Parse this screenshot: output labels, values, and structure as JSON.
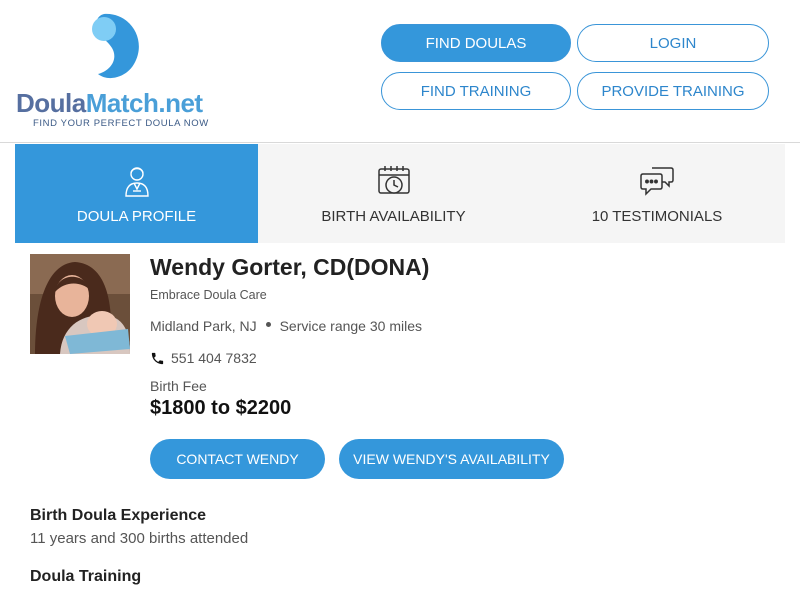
{
  "brand": {
    "logo_word_part1": "Doula",
    "logo_word_part2": "Match.net",
    "tagline": "FIND YOUR PERFECT DOULA NOW",
    "colors": {
      "primary": "#3497db",
      "dark_blue": "#566fa0",
      "light_blue": "#67c0f0"
    }
  },
  "nav": {
    "find_doulas": "FIND DOULAS",
    "login": "LOGIN",
    "find_training": "FIND TRAINING",
    "provide_training": "PROVIDE TRAINING"
  },
  "tabs": [
    {
      "label": "DOULA PROFILE",
      "icon": "doula-profile-icon",
      "active": true
    },
    {
      "label": "BIRTH AVAILABILITY",
      "icon": "calendar-clock-icon",
      "active": false
    },
    {
      "label": "10 TESTIMONIALS",
      "icon": "chat-bubbles-icon",
      "active": false
    }
  ],
  "profile": {
    "name": "Wendy Gorter, CD(DONA)",
    "organization": "Embrace Doula Care",
    "location": "Midland Park, NJ",
    "service_range": "Service range 30 miles",
    "phone": "551 404 7832",
    "fee_label": "Birth Fee",
    "fee": "$1800 to $2200",
    "contact_button": "CONTACT WENDY",
    "availability_button": "VIEW WENDY'S AVAILABILITY"
  },
  "sections": {
    "experience_heading": "Birth Doula Experience",
    "experience_text": "11 years and 300 births attended",
    "training_heading": "Doula Training"
  }
}
